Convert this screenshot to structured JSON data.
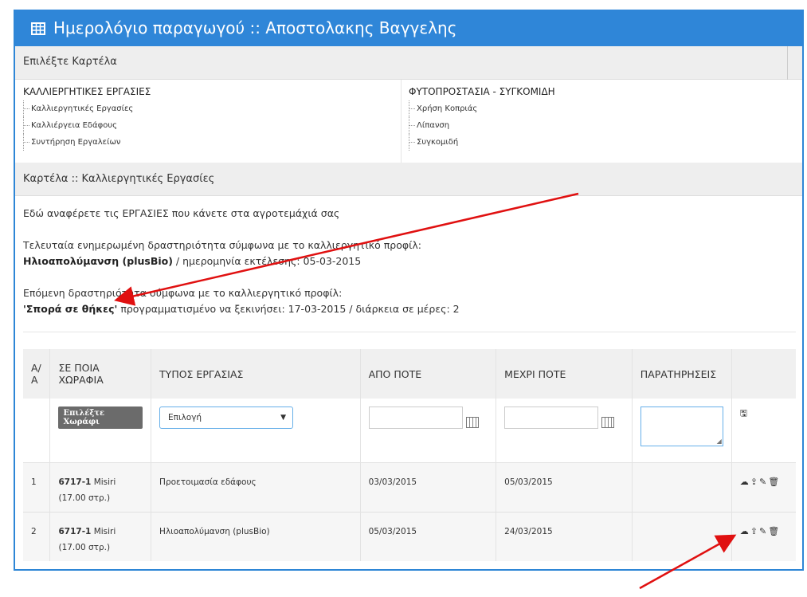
{
  "header": {
    "title": "Ημερολόγιο παραγωγού :: Αποστολακης Βαγγελης"
  },
  "tab_select": {
    "label": "Επιλέξτε Καρτέλα"
  },
  "tree_left": {
    "root": "ΚΑΛΛΙΕΡΓΗΤΙΚΕΣ ΕΡΓΑΣΙΕΣ",
    "items": [
      "Καλλιεργητικές Εργασίες",
      "Καλλιέργεια Εδάφους",
      "Συντήρηση Εργαλείων"
    ]
  },
  "tree_right": {
    "root": "ΦΥΤΟΠΡΟΣΤΑΣΙΑ - ΣΥΓΚΟΜΙΔΗ",
    "items": [
      "Χρήση Κοπριάς",
      "Λίπανση",
      "Συγκομιδή"
    ]
  },
  "card": {
    "title": "Καρτέλα :: Καλλιεργητικές Εργασίες"
  },
  "info": {
    "intro": "Εδώ αναφέρετε τις ΕΡΓΑΣΙΕΣ που κάνετε στα αγροτεμάχιά σας",
    "last_label": "Τελευταία ενημερωμένη δραστηριότητα σύμφωνα με το καλλιεργητικό προφίλ:",
    "last_activity": "Ηλιοαπολύμανση (plusBio)",
    "last_detail": " / ημερομηνία εκτέλεσης: 05-03-2015",
    "next_label": "Επόμενη δραστηριότητα σύμφωνα με το καλλιεργητικό προφίλ:",
    "next_activity": "'Σπορά σε θήκες'",
    "next_detail": " προγραμματισμένο να ξεκινήσει: 17-03-2015 / διάρκεια σε μέρες: 2"
  },
  "table": {
    "headers": [
      "Α/Α",
      "ΣΕ ΠΟΙΑ ΧΩΡΑΦΙΑ",
      "ΤΥΠΟΣ ΕΡΓΑΣΙΑΣ",
      "ΑΠΟ ΠΟΤΕ",
      "ΜΕΧΡΙ ΠΟΤΕ",
      "ΠΑΡΑΤΗΡΗΣΕΙΣ",
      ""
    ],
    "filter": {
      "field_button": "Επιλέξτε Χωράφι",
      "type_select": "Επιλογή"
    },
    "rows": [
      {
        "idx": "1",
        "field_code": "6717-1",
        "field_name": " Misiri (17.00 στρ.)",
        "type": "Προετοιμασία εδάφους",
        "from": "03/03/2015",
        "to": "05/03/2015",
        "notes": ""
      },
      {
        "idx": "2",
        "field_code": "6717-1",
        "field_name": " Misiri (17.00 στρ.)",
        "type": "Ηλιοαπολύμανση (plusBio)",
        "from": "05/03/2015",
        "to": "24/03/2015",
        "notes": ""
      }
    ]
  },
  "icons": {
    "grid": "table-grid-icon",
    "calendar": "calendar-icon",
    "save": "floppy-icon",
    "actions": [
      "cloud-icon",
      "cloud-upload-icon",
      "edit-icon",
      "trash-icon"
    ]
  },
  "colors": {
    "header": "#2f86d8",
    "annotation_arrow": "#e01010"
  }
}
